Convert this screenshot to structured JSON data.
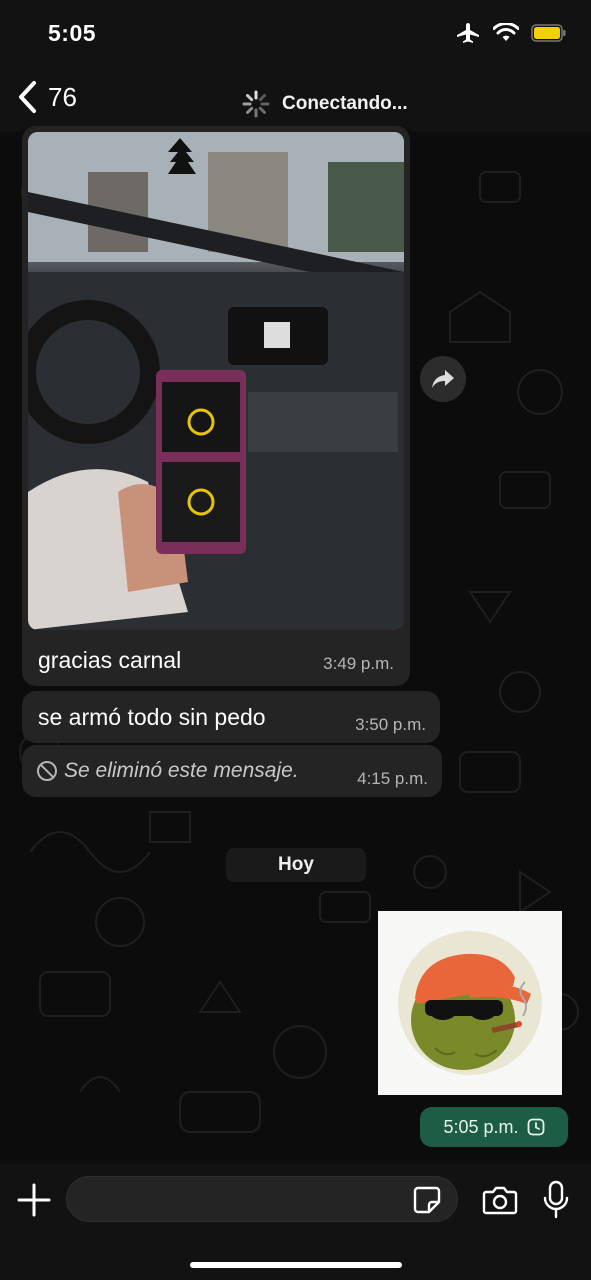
{
  "status_bar": {
    "time": "5:05",
    "icons": [
      "airplane-icon",
      "wifi-icon",
      "battery-icon"
    ],
    "battery_color": "#f5d000"
  },
  "header": {
    "back_count": "76",
    "status": "Conectando..."
  },
  "messages": [
    {
      "type": "image",
      "caption": "gracias carnal",
      "time": "3:49 p.m."
    },
    {
      "type": "text",
      "text": "se armó todo sin pedo",
      "time": "3:50 p.m."
    },
    {
      "type": "deleted",
      "text": "Se eliminó este mensaje.",
      "time": "4:15 p.m."
    }
  ],
  "day_separator": "Hoy",
  "sent": {
    "type": "sticker",
    "time": "5:05 p.m.",
    "status_icon": "clock-icon"
  },
  "input": {
    "placeholder": ""
  },
  "colors": {
    "bubble": "#242424",
    "sent_chip": "#1e5d45",
    "sticker_cap": "#e8663a"
  }
}
